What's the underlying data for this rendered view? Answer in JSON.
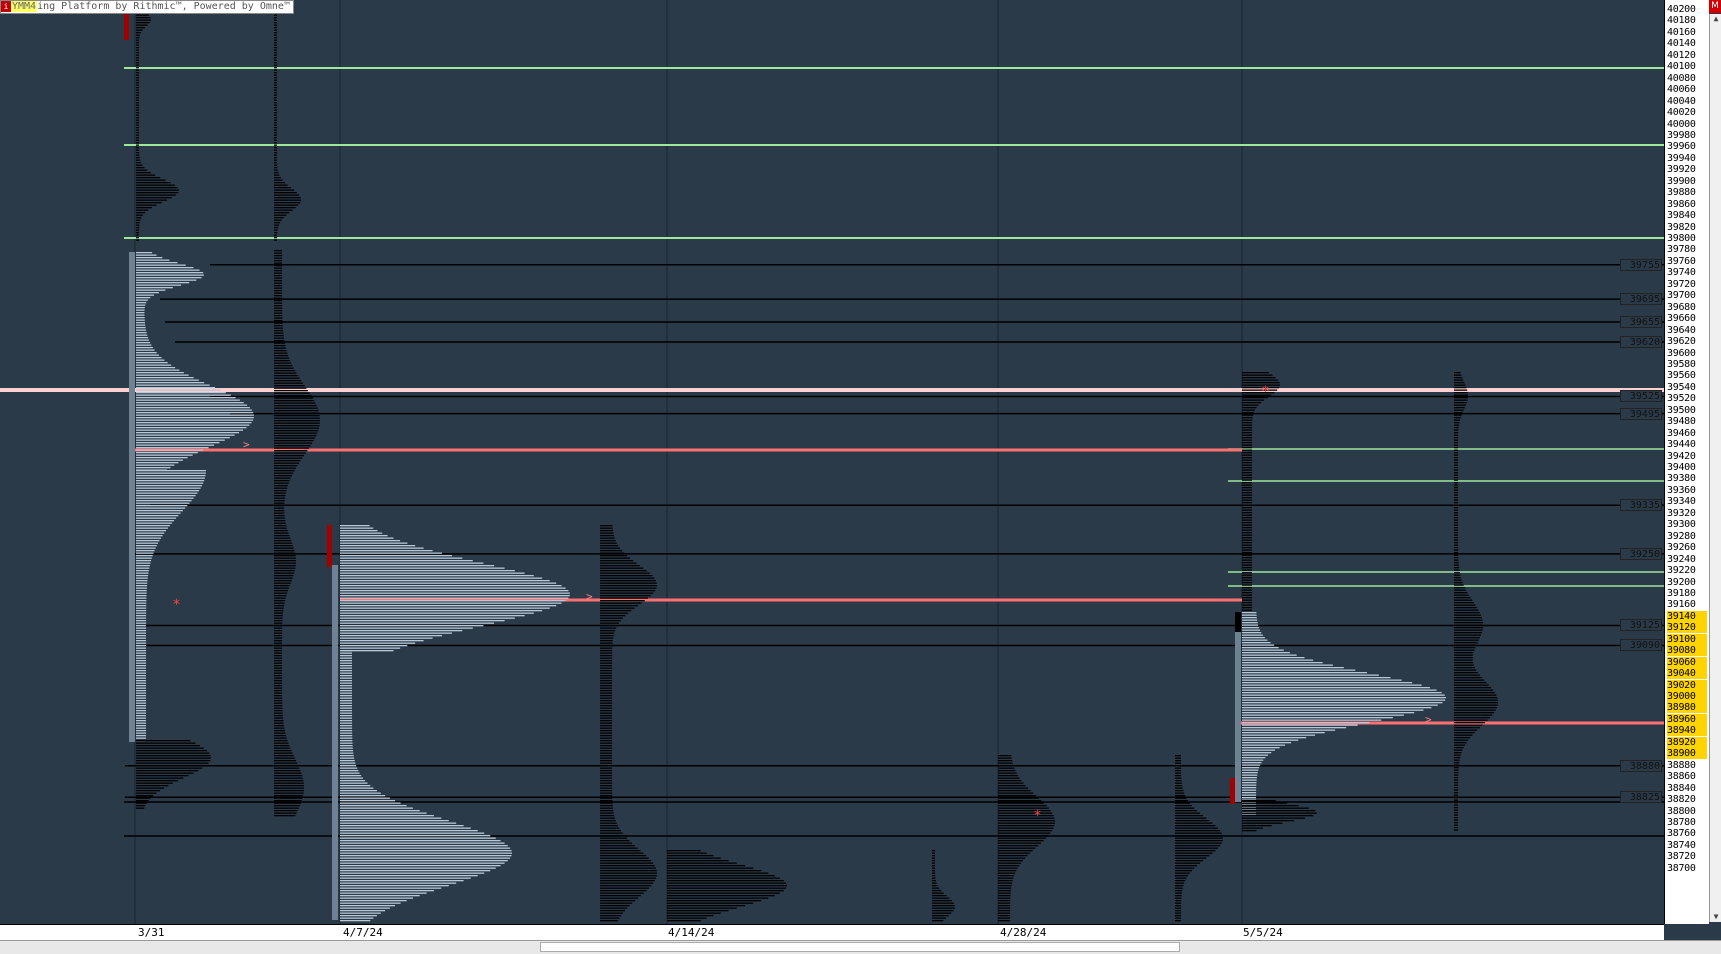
{
  "title_bar": {
    "symbol": "YMM4",
    "text": "ing Platform by Rithmic™, Powered by Omne™",
    "icon": "i"
  },
  "top_right_button": "M",
  "price_axis": {
    "labels": [
      "40200",
      "40180",
      "40160",
      "40140",
      "40120",
      "40100",
      "40080",
      "40060",
      "40040",
      "40020",
      "40000",
      "39980",
      "39960",
      "39940",
      "39920",
      "39900",
      "39880",
      "39860",
      "39840",
      "39820",
      "39800",
      "39780",
      "39760",
      "39740",
      "39720",
      "39700",
      "39680",
      "39660",
      "39640",
      "39620",
      "39600",
      "39580",
      "39560",
      "39540",
      "39520",
      "39500",
      "39480",
      "39460",
      "39440",
      "39420",
      "39400",
      "39380",
      "39360",
      "39340",
      "39320",
      "39300",
      "39280",
      "39260",
      "39240",
      "39220",
      "39200",
      "39180",
      "39160",
      "39140",
      "39120",
      "39100",
      "39080",
      "39060",
      "39040",
      "39020",
      "39000",
      "38980",
      "38960",
      "38940",
      "38920",
      "38900",
      "38880",
      "38860",
      "38840",
      "38820",
      "38800",
      "38780",
      "38760",
      "38740",
      "38720",
      "38700"
    ],
    "highlighted_range": [
      "39140",
      "38900"
    ],
    "highlight_color": "#ffd400"
  },
  "level_tags": [
    "39755",
    "39695",
    "39655",
    "39620",
    "39525",
    "39495",
    "39335",
    "39250",
    "39125",
    "39090",
    "38880",
    "38825"
  ],
  "date_axis": {
    "labels": [
      "3/31",
      "4/7/24",
      "4/14/24",
      "4/28/24",
      "5/5/24"
    ]
  },
  "colors": {
    "background": "#2b3a48",
    "green_line": "#9ee89e",
    "poc_line": "#ff7070",
    "highlight_line": "#ffd0d0",
    "profile_light": "#b8c8d8",
    "profile_dark": "#000000",
    "value_area_bar": "#6f8294",
    "range_marker": "#a00000"
  }
}
